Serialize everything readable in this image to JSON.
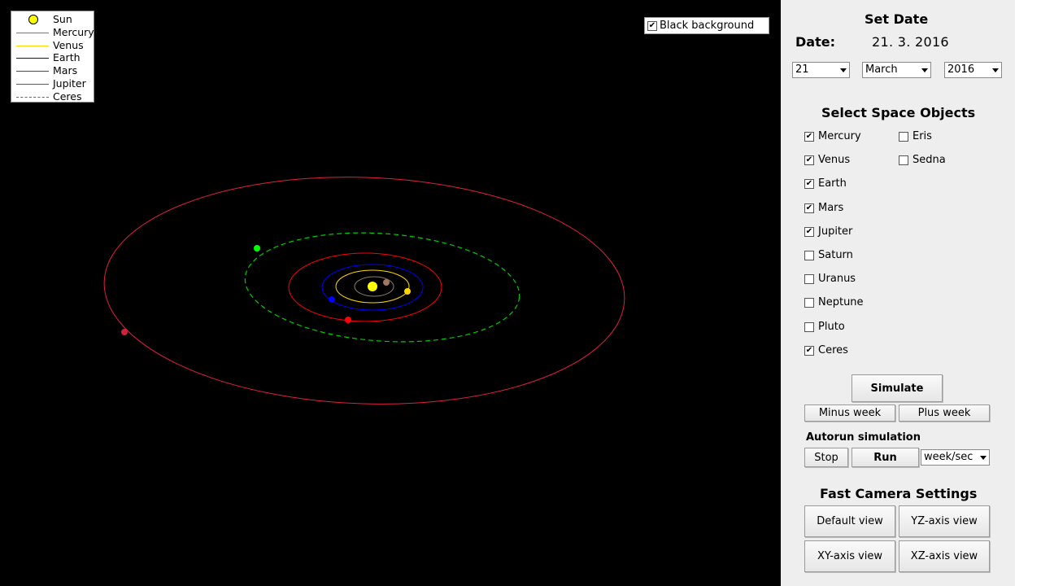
{
  "colors": {
    "sun": "#ffff00",
    "mercury": "#a08060",
    "venus": "#ffd700",
    "earth": "#0000ff",
    "mars": "#ff0000",
    "jupiter": "#e0203a",
    "ceres": "#00ff00"
  },
  "legend": [
    {
      "label": "Sun",
      "type": "sun",
      "color": "#ffff00"
    },
    {
      "label": "Mercury",
      "type": "line",
      "color": "#777777"
    },
    {
      "label": "Venus",
      "type": "line",
      "color": "#ffd700"
    },
    {
      "label": "Earth",
      "type": "line",
      "color": "#0000cc"
    },
    {
      "label": "Mars",
      "type": "line",
      "color": "#ff0000"
    },
    {
      "label": "Jupiter",
      "type": "line",
      "color": "#e0203a"
    },
    {
      "label": "Ceres",
      "type": "dashed",
      "color": "#00aa00"
    }
  ],
  "black_background": {
    "label": "Black background",
    "checked": true
  },
  "date_panel": {
    "heading": "Set Date",
    "date_label": "Date:",
    "date_value": "21. 3. 2016",
    "day": "21",
    "month": "March",
    "year": "2016"
  },
  "objects_panel": {
    "heading": "Select Space Objects",
    "left": [
      {
        "label": "Mercury",
        "checked": true
      },
      {
        "label": "Venus",
        "checked": true
      },
      {
        "label": "Earth",
        "checked": true
      },
      {
        "label": "Mars",
        "checked": true
      },
      {
        "label": "Jupiter",
        "checked": true
      },
      {
        "label": "Saturn",
        "checked": false
      },
      {
        "label": "Uranus",
        "checked": false
      },
      {
        "label": "Neptune",
        "checked": false
      },
      {
        "label": "Pluto",
        "checked": false
      },
      {
        "label": "Ceres",
        "checked": true
      }
    ],
    "right": [
      {
        "label": "Eris",
        "checked": false
      },
      {
        "label": "Sedna",
        "checked": false
      }
    ]
  },
  "simulation": {
    "simulate_label": "Simulate",
    "minus_week_label": "Minus week",
    "plus_week_label": "Plus week",
    "autorun_heading": "Autorun simulation",
    "stop_label": "Stop",
    "run_label": "Run",
    "speed_value": "week/sec"
  },
  "camera": {
    "heading": "Fast Camera Settings",
    "default_label": "Default view",
    "yz_label": "YZ-axis view",
    "xy_label": "XY-axis view",
    "xz_label": "XZ-axis view"
  }
}
